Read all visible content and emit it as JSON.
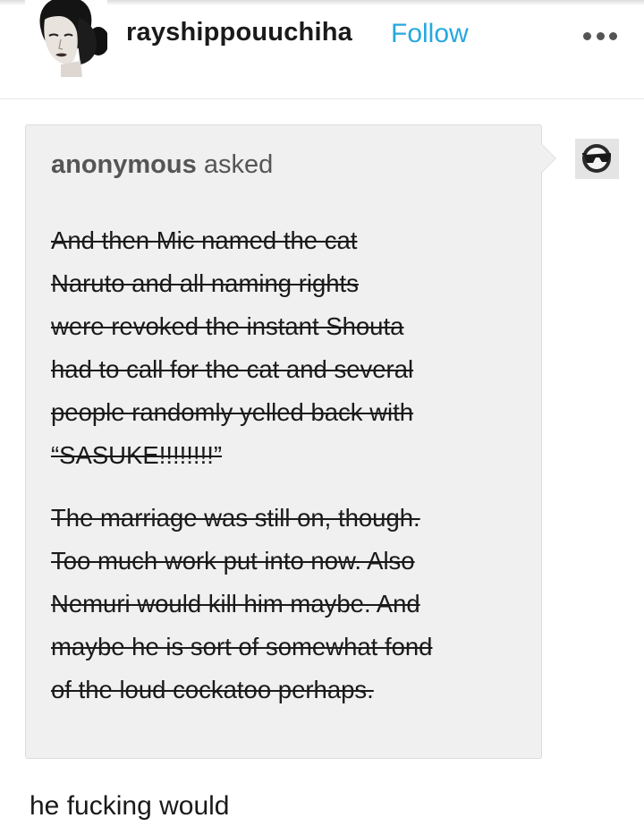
{
  "post": {
    "username": "rayshippouuchiha",
    "follow_label": "Follow",
    "more_icon": "more-dots-icon"
  },
  "ask": {
    "asker_name": "anonymous",
    "asked_label": "asked",
    "paragraphs": [
      "And then Mic named the cat\nNaruto and all naming rights\nwere revoked the instant Shouta\nhad to call for the cat and several\npeople randomly yelled back with\n“SASUKE!!!!!!!!” ",
      "The marriage was still on, though.\nToo much work put into now. Also\nNemuri would kill him maybe. And\nmaybe he is sort of somewhat fond\nof the loud cockatoo perhaps. "
    ],
    "anon_avatar_icon": "anonymous-sunglasses-icon"
  },
  "answer": {
    "text": "he fucking would"
  },
  "colors": {
    "follow": "#26a8e0",
    "ask_background": "#f0f0f0",
    "text": "#1a1a1a"
  }
}
